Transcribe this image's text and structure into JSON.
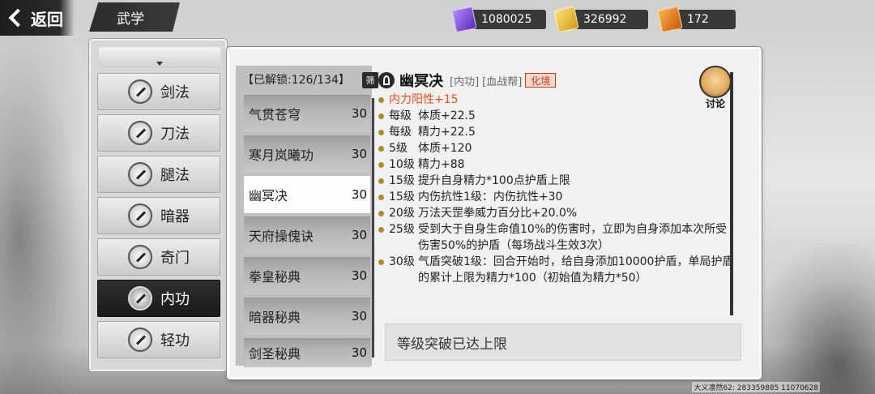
{
  "nav": {
    "back_label": "返回",
    "page_title": "武学"
  },
  "currencies": [
    {
      "icon": "purple-gem-icon",
      "amount": "1080025"
    },
    {
      "icon": "gold-ticket-icon",
      "amount": "326992"
    },
    {
      "icon": "orange-token-icon",
      "amount": "172"
    }
  ],
  "categories": [
    {
      "label": "剑法",
      "icon": "sword-icon",
      "active": false
    },
    {
      "label": "刀法",
      "icon": "blade-icon",
      "active": false
    },
    {
      "label": "腿法",
      "icon": "kick-icon",
      "active": false
    },
    {
      "label": "暗器",
      "icon": "shuriken-icon",
      "active": false
    },
    {
      "label": "奇门",
      "icon": "staff-icon",
      "active": false
    },
    {
      "label": "内功",
      "icon": "meditation-icon",
      "active": true
    },
    {
      "label": "轻功",
      "icon": "lightness-icon",
      "active": false
    }
  ],
  "skill_list": {
    "unlock_label": "【已解锁:126/134】",
    "filter_label": "筛",
    "items": [
      {
        "name": "气贯苍穹",
        "level": "30",
        "active": false
      },
      {
        "name": "寒月岚曦功",
        "level": "30",
        "active": false
      },
      {
        "name": "幽冥决",
        "level": "30",
        "active": true
      },
      {
        "name": "天府操傀诀",
        "level": "30",
        "active": false
      },
      {
        "name": "拳皇秘典",
        "level": "30",
        "active": false
      },
      {
        "name": "暗器秘典",
        "level": "30",
        "active": false
      },
      {
        "name": "剑圣秘典",
        "level": "30",
        "active": false
      }
    ]
  },
  "detail": {
    "name": "幽冥决",
    "type_tag": "[内功]",
    "faction_tag": "[血战帮]",
    "realm_tag": "化境",
    "discuss_label": "讨论",
    "effects": [
      {
        "level": "",
        "text": "内力阳性+15",
        "highlight": true
      },
      {
        "level": "每级",
        "text": "体质+22.5",
        "highlight": false
      },
      {
        "level": "每级",
        "text": "精力+22.5",
        "highlight": false
      },
      {
        "level": "5级",
        "text": "体质+120",
        "highlight": false
      },
      {
        "level": "10级",
        "text": "精力+88",
        "highlight": false
      },
      {
        "level": "15级",
        "text": "提升自身精力*100点护盾上限",
        "highlight": false
      },
      {
        "level": "15级",
        "text": "内伤抗性1级：内伤抗性+30",
        "highlight": false
      },
      {
        "level": "20级",
        "text": "万法天罡拳威力百分比+20.0%",
        "highlight": false
      },
      {
        "level": "25级",
        "text": "受到大于自身生命值10%的伤害时，立即为自身添加本次所受伤害50%的护盾（每场战斗生效3次）",
        "highlight": false
      },
      {
        "level": "30级",
        "text": "气盾突破1级：回合开始时，给自身添加10000护盾，单局护盾的累计上限为精力*100（初始值为精力*50）",
        "highlight": false
      }
    ],
    "breakthrough_text": "等级突破已达上限"
  },
  "footer": {
    "player_id": "大义凛然62: 283359885 11070628"
  },
  "colors": {
    "highlight": "#e84b1a",
    "realm": "#c63b1e",
    "active_category": "#1a1a1a"
  }
}
